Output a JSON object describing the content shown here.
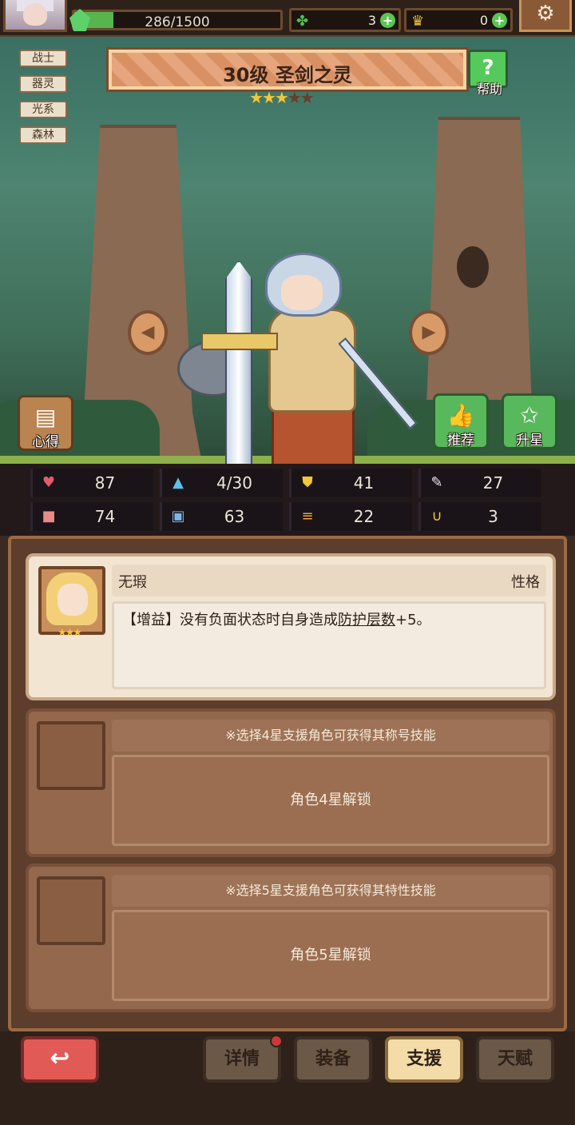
{
  "topbar": {
    "xp_text": "286/1500",
    "xp_fraction": 0.19,
    "clover_count": "3",
    "bone_count": "0"
  },
  "tags": [
    "战士",
    "器灵",
    "光系",
    "森林"
  ],
  "hero": {
    "title": "30级  圣剑之灵",
    "stars_filled": 3,
    "stars_total": 5
  },
  "buttons": {
    "help": "帮助",
    "help_icon": "?",
    "notes": "心得",
    "recommend": "推荐",
    "star_up": "升星"
  },
  "stats": [
    {
      "icon": "heart-icon",
      "value": "87",
      "color": "#e35b6e"
    },
    {
      "icon": "drop-icon",
      "value": "4/30",
      "color": "#5fc0e6"
    },
    {
      "icon": "shield-icon",
      "value": "41",
      "color": "#f4c63a"
    },
    {
      "icon": "feather-icon",
      "value": "27",
      "color": "#e9e9e9"
    },
    {
      "icon": "fist-icon",
      "value": "74",
      "color": "#e88b86"
    },
    {
      "icon": "book-icon",
      "value": "63",
      "color": "#7fb6e6"
    },
    {
      "icon": "speed-icon",
      "value": "22",
      "color": "#f2a43a"
    },
    {
      "icon": "magnet-icon",
      "value": "3",
      "color": "#f4c63a"
    }
  ],
  "support": {
    "card1": {
      "name": "无瑕",
      "trait_label": "性格",
      "desc_prefix": "【增益】没有负面状态时自身造成",
      "desc_highlight": "防护层数",
      "desc_suffix": "+5。"
    },
    "card2": {
      "hint": "※选择4星支援角色可获得其称号技能",
      "lock": "角色4星解锁"
    },
    "card3": {
      "hint": "※选择5星支援角色可获得其特性技能",
      "lock": "角色5星解锁"
    }
  },
  "nav": {
    "details": "详情",
    "equipment": "装备",
    "support": "支援",
    "talent": "天赋"
  }
}
